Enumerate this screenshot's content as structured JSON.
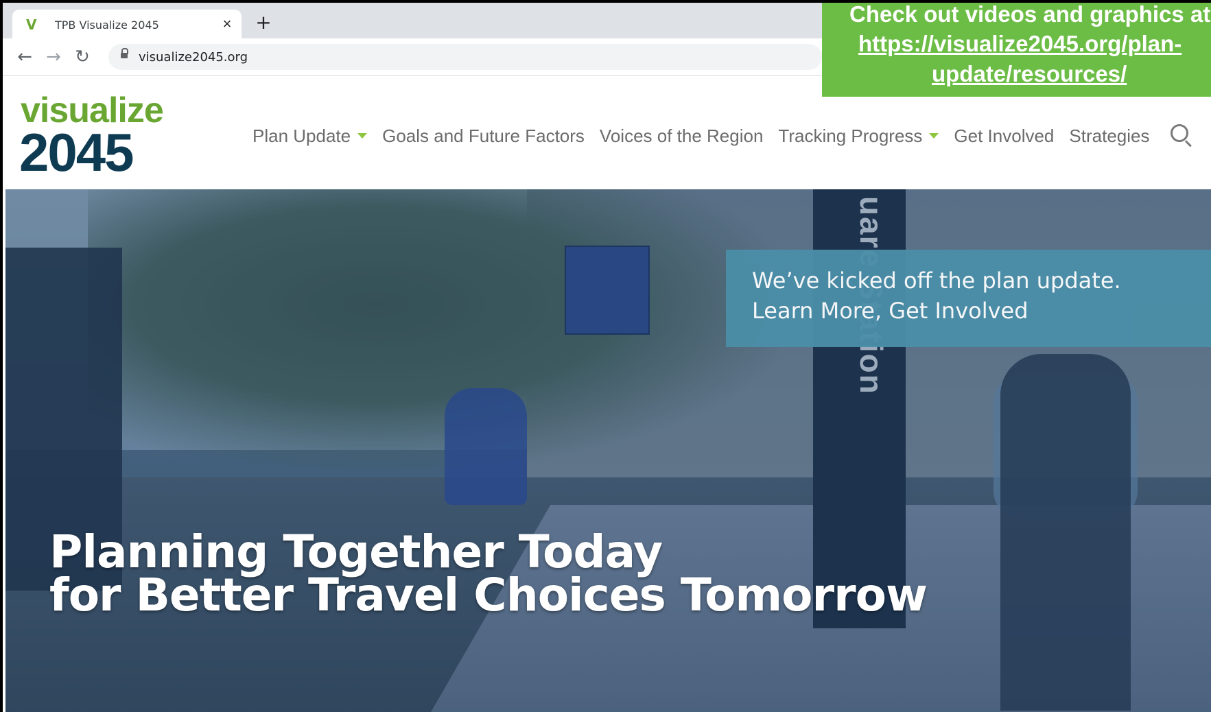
{
  "browser": {
    "tab_title": "TPB Visualize 2045",
    "tab_favicon": "V",
    "tab_close": "×",
    "new_tab": "+",
    "url": "visualize2045.org",
    "back": "←",
    "forward": "→",
    "reload": "↻"
  },
  "banner": {
    "line1": "Check out videos and graphics at",
    "line2": "https://visualize2045.org/plan-",
    "line3": "update/resources/",
    "color": "#6cbd45"
  },
  "logo": {
    "top": "visualize",
    "bottom": "2045"
  },
  "nav": {
    "items": [
      {
        "label": "Plan Update",
        "has_dropdown": true
      },
      {
        "label": "Goals and Future Factors",
        "has_dropdown": false
      },
      {
        "label": "Voices of the Region",
        "has_dropdown": false
      },
      {
        "label": "Tracking Progress",
        "has_dropdown": true
      },
      {
        "label": "Get Involved",
        "has_dropdown": false
      },
      {
        "label": "Strategies",
        "has_dropdown": false
      }
    ],
    "search_icon": "search-icon",
    "accent": "#8dc63f"
  },
  "hero": {
    "station_sign": "uare Station",
    "notice_line1": "We’ve kicked off the plan update.",
    "notice_line2": "Learn More, Get Involved",
    "headline_line1": "Planning Together Today",
    "headline_line2": "for Better Travel Choices Tomorrow"
  }
}
